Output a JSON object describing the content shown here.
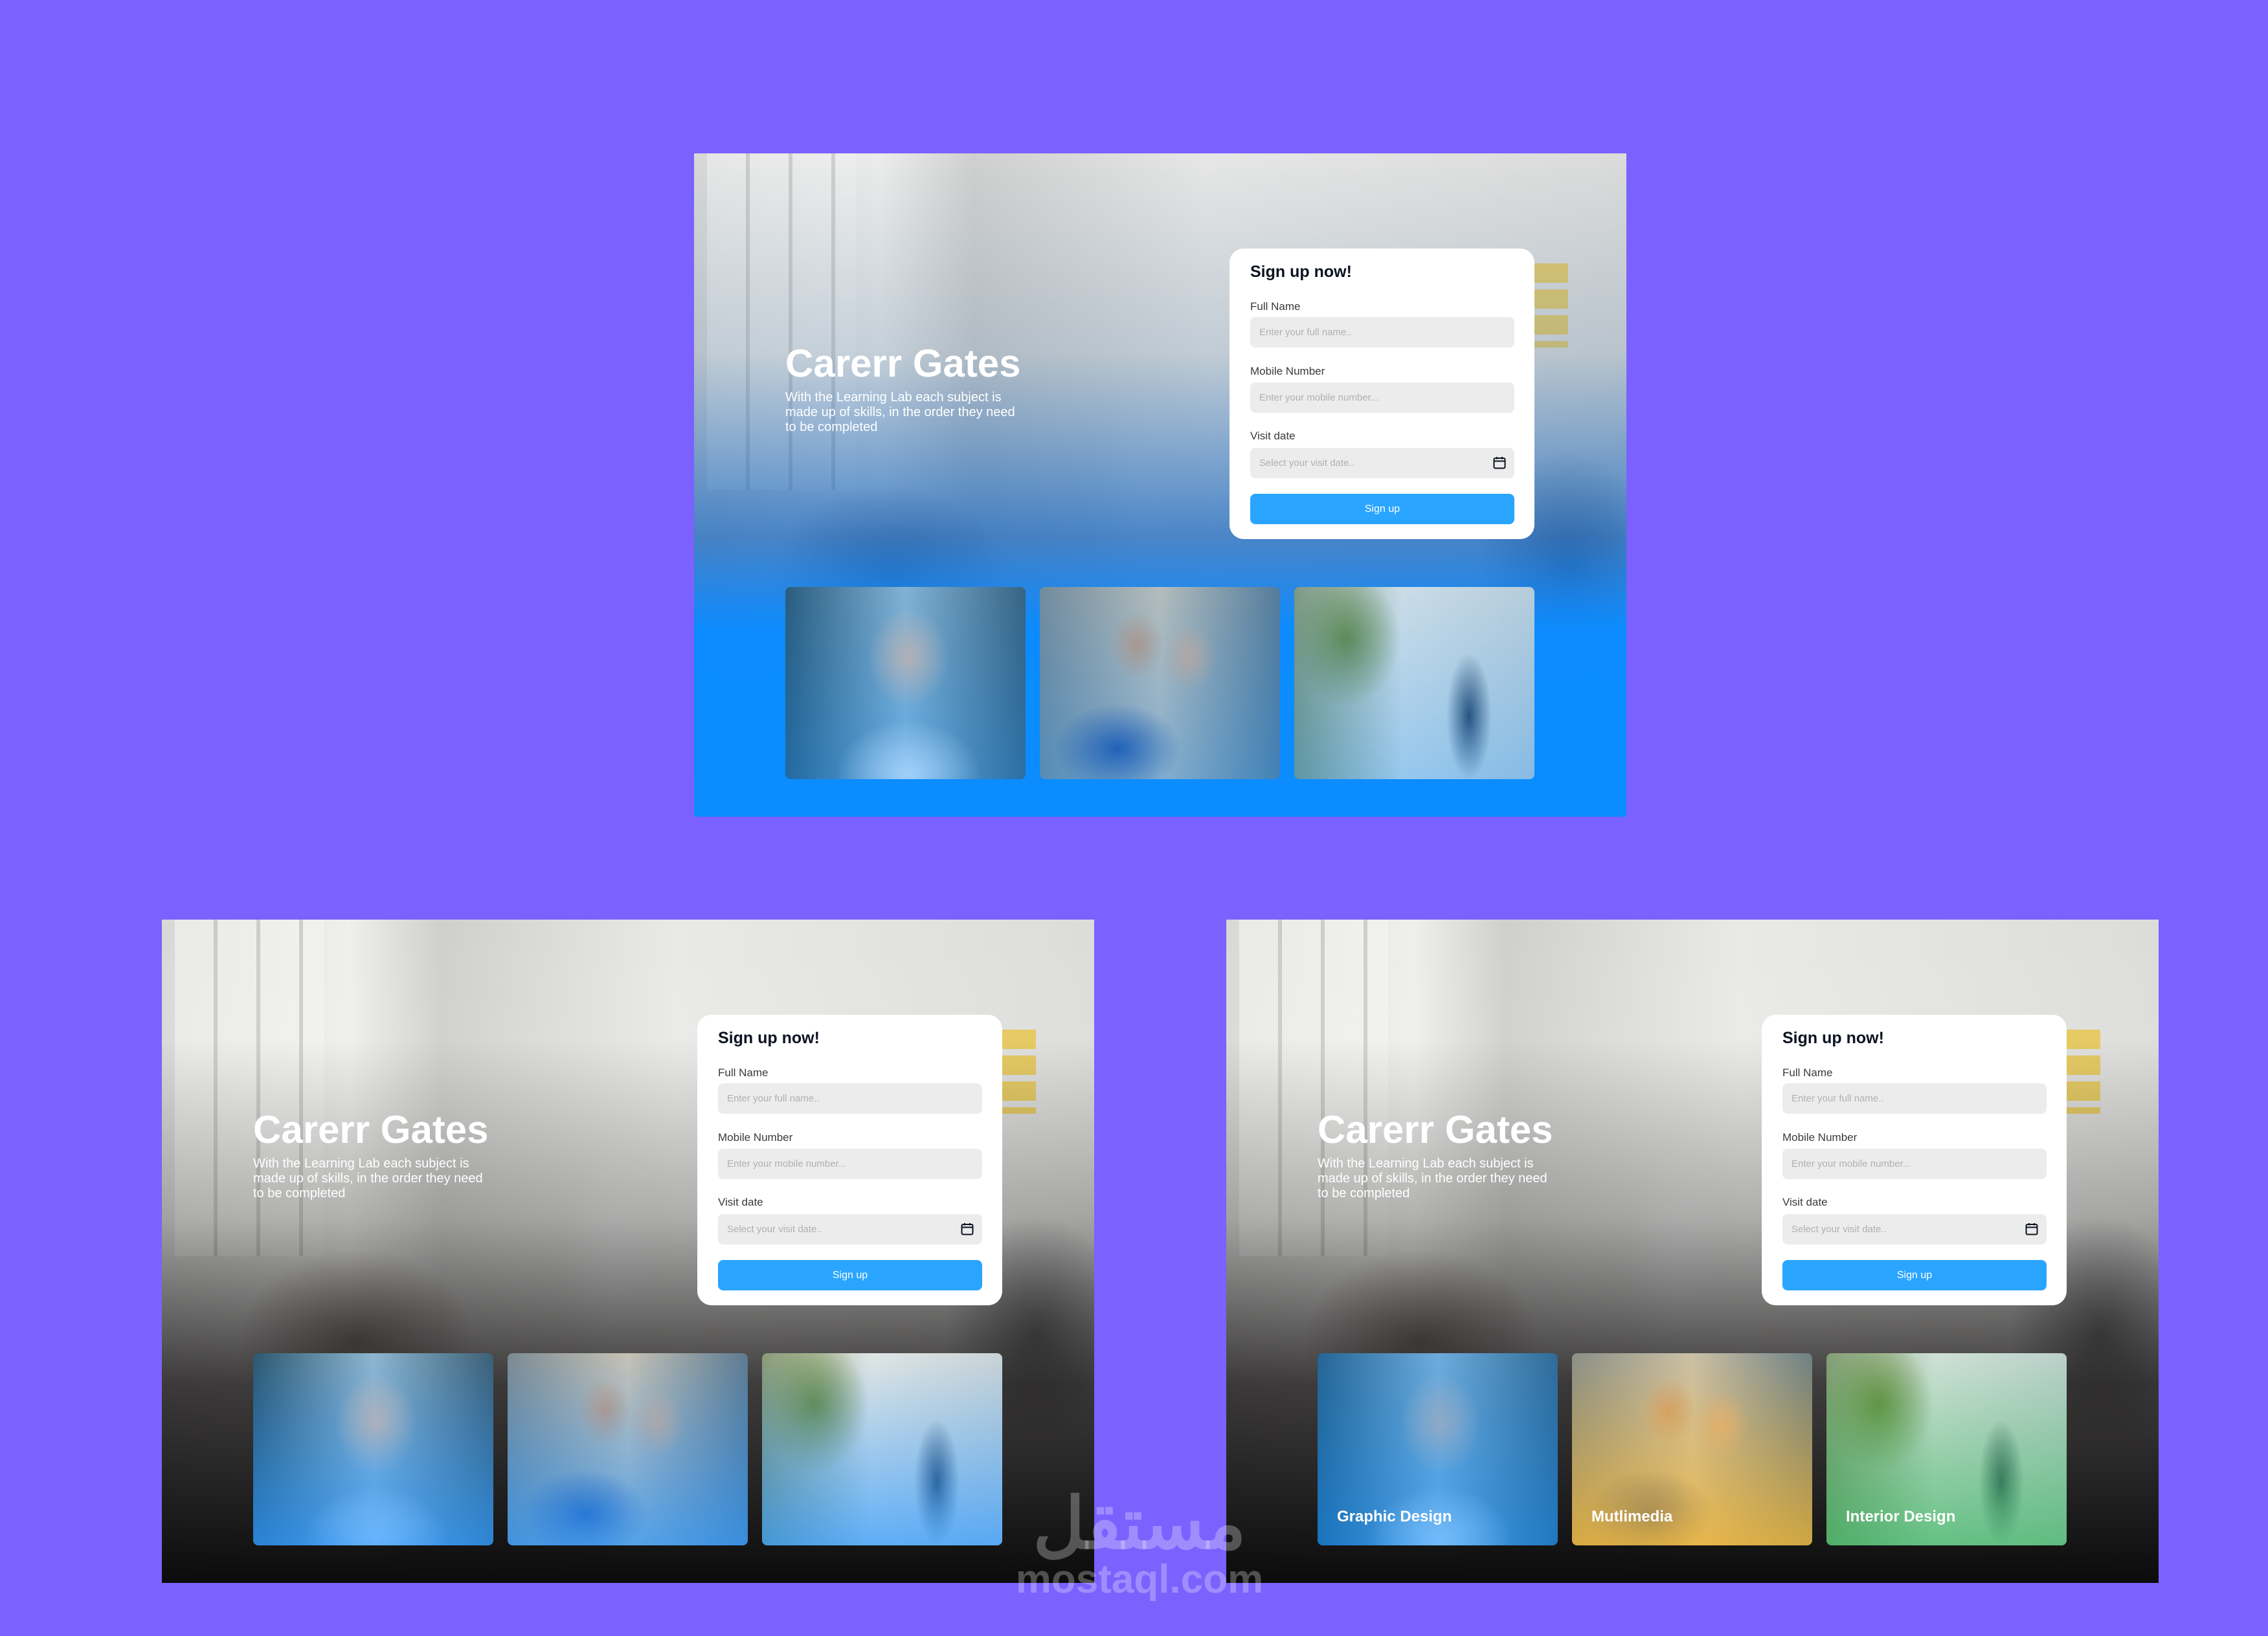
{
  "colors": {
    "background": "#7b62fe",
    "accent": "#2aa5ff",
    "hero_blue": "#0b8dff"
  },
  "mockups": [
    {
      "variant": "blue",
      "hero": {
        "title": "Carerr Gates",
        "subtitle": "With the Learning Lab each subject is made up of skills, in the order they need to be completed"
      },
      "form": {
        "title": "Sign up now!",
        "full_name_label": "Full Name",
        "full_name_placeholder": "Enter your full name..",
        "mobile_label": "Mobile Number",
        "mobile_placeholder": "Enter your mobile number...",
        "date_label": "Visit date",
        "date_placeholder": "Select your visit date..",
        "date_icon": "calendar-icon",
        "submit_label": "Sign up"
      },
      "thumbs": [
        {
          "label": ""
        },
        {
          "label": ""
        },
        {
          "label": ""
        }
      ]
    },
    {
      "variant": "dark",
      "hero": {
        "title": "Carerr Gates",
        "subtitle": "With the Learning Lab each subject is made up of skills, in the order they need to be completed"
      },
      "form": {
        "title": "Sign up now!",
        "full_name_label": "Full Name",
        "full_name_placeholder": "Enter your full name..",
        "mobile_label": "Mobile Number",
        "mobile_placeholder": "Enter your mobile number...",
        "date_label": "Visit date",
        "date_placeholder": "Select your visit date..",
        "date_icon": "calendar-icon",
        "submit_label": "Sign up"
      },
      "thumbs": [
        {
          "label": ""
        },
        {
          "label": ""
        },
        {
          "label": ""
        }
      ]
    },
    {
      "variant": "dark-labeled",
      "hero": {
        "title": "Carerr Gates",
        "subtitle": "With the Learning Lab each subject is made up of skills, in the order they need to be completed"
      },
      "form": {
        "title": "Sign up now!",
        "full_name_label": "Full Name",
        "full_name_placeholder": "Enter your full name..",
        "mobile_label": "Mobile Number",
        "mobile_placeholder": "Enter your mobile number...",
        "date_label": "Visit date",
        "date_placeholder": "Select your visit date..",
        "date_icon": "calendar-icon",
        "submit_label": "Sign up"
      },
      "thumbs": [
        {
          "label": "Graphic Design"
        },
        {
          "label": "Mutlimedia"
        },
        {
          "label": "Interior Design"
        }
      ]
    }
  ],
  "watermark": {
    "arabic": "مستقل",
    "latin": "mostaql.com"
  }
}
